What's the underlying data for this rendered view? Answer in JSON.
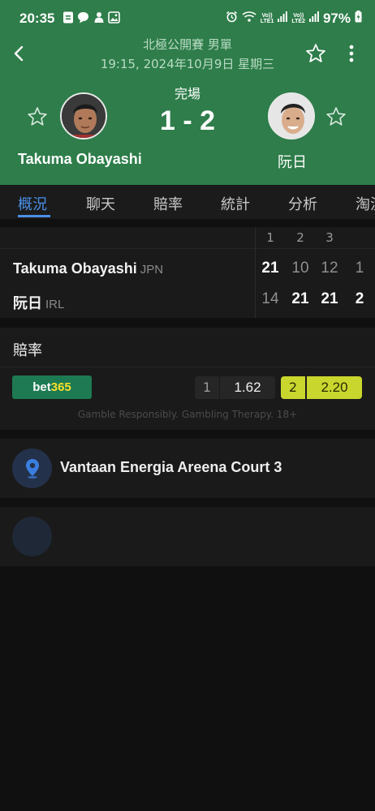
{
  "status_bar": {
    "time": "20:35",
    "volte1": "Vo))\nLTE1",
    "volte2": "Vo))\nLTE2",
    "battery": "97%"
  },
  "header": {
    "tournament": "北極公開賽 男單",
    "datetime": "19:15, 2024年10月9日 星期三",
    "status": "完場",
    "score": "1 - 2",
    "player_left": "Takuma Obayashi",
    "player_right": "阮日",
    "icons": {
      "back": "back-arrow-icon",
      "favorite": "star-outline-icon",
      "more": "more-vertical-icon"
    }
  },
  "tabs": [
    "概況",
    "聊天",
    "賠率",
    "統計",
    "分析",
    "淘汰"
  ],
  "active_tab": 0,
  "scorecard": {
    "set_headers": [
      "1",
      "2",
      "3"
    ],
    "rows": [
      {
        "name": "Takuma Obayashi",
        "country": "JPN",
        "sets": [
          "21",
          "10",
          "12"
        ],
        "total": "1",
        "set_win": [
          true,
          false,
          false
        ],
        "total_win": false
      },
      {
        "name": "阮日",
        "country": "IRL",
        "sets": [
          "14",
          "21",
          "21"
        ],
        "total": "2",
        "set_win": [
          false,
          true,
          true
        ],
        "total_win": true
      }
    ]
  },
  "odds": {
    "title": "賠率",
    "bookmaker_a": "bet",
    "bookmaker_b": "365",
    "home_label": "1",
    "home_value": "1.62",
    "away_label": "2",
    "away_value": "2.20",
    "disclaimer": "Gamble Responsibly. Gambling Therapy. 18+",
    "colors": {
      "bookmaker_bg": "#1d7a52",
      "highlight": "#c9d62e"
    }
  },
  "venue": {
    "name": "Vantaan Energia Areena Court 3",
    "icon": "location-pin-icon"
  },
  "colors": {
    "header_bg": "#2e7d4a",
    "accent": "#4a8fe7",
    "page_bg": "#101010"
  }
}
